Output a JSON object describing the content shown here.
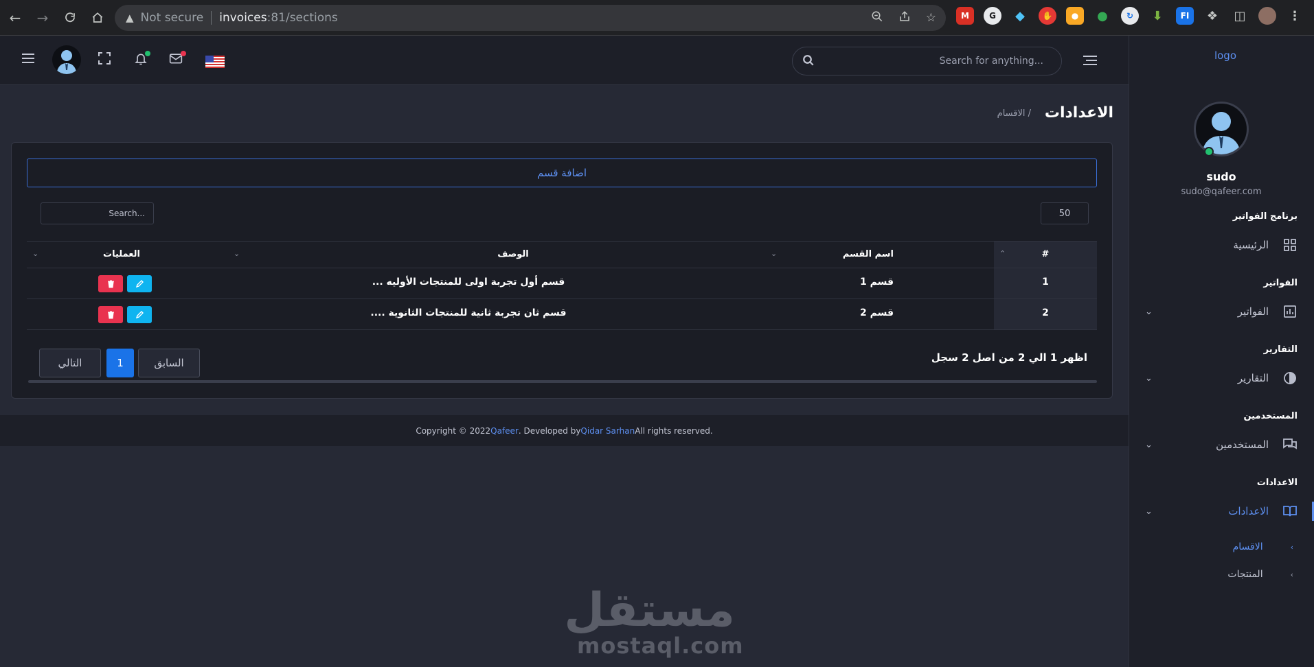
{
  "browser": {
    "not_secure": "Not secure",
    "host": "invoices",
    "path": ":81/sections"
  },
  "header": {
    "search_placeholder": "Search for anything..."
  },
  "sidebar": {
    "logo_alt": "logo",
    "user_name": "sudo",
    "user_email": "sudo@qafeer.com",
    "sections": [
      {
        "title": "برنامج الفواتير",
        "item": "الرئيسية"
      },
      {
        "title": "الفواتير",
        "item": "الفواتير"
      },
      {
        "title": "التقارير",
        "item": "التقارير"
      },
      {
        "title": "المستخدمين",
        "item": "المستخدمين"
      },
      {
        "title": "الاعدادات",
        "item": "الاعدادات"
      }
    ],
    "sub_items": [
      "الاقسام",
      "المنتجات"
    ]
  },
  "page": {
    "title": "الاعدادات",
    "breadcrumb": "/ الاقسام",
    "add_button": "اضافة قسم",
    "page_size": "50",
    "table_search_placeholder": "Search...",
    "columns": {
      "num": "#",
      "name": "اسم القسم",
      "desc": "الوصف",
      "ops": "العمليات"
    },
    "rows": [
      {
        "num": "1",
        "name": "قسم 1",
        "desc": "قسم أول تجربة اولى للمنتجات الأوليه ..."
      },
      {
        "num": "2",
        "name": "قسم 2",
        "desc": "قسم ثان تجربة ثانية للمنتجات الثانوية ...."
      }
    ],
    "info": "اظهر 1 الي 2 من اصل 2 سجل",
    "prev": "السابق",
    "current": "1",
    "next": "التالي"
  },
  "footer": {
    "copyright": "Copyright © 2022 ",
    "brand": "Qafeer",
    "developed": ". Developed by ",
    "developer": "Qidar Sarhan",
    "rights": " All rights reserved."
  },
  "watermark": {
    "arabic": "مستقل",
    "latin": "mostaql.com"
  },
  "colors": {
    "accent": "#5d8ff0",
    "delete": "#e9334f",
    "edit": "#0fb4f0",
    "page_bg": "#262935"
  }
}
